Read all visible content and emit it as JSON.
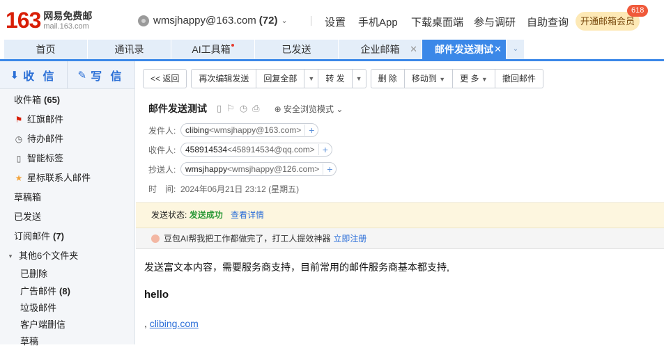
{
  "logo": {
    "number": "163",
    "cn": "网易免费邮",
    "url": "mail.163.com"
  },
  "account": {
    "email": "wmsjhappy@163.com",
    "count": "(72)"
  },
  "topnav": [
    "设置",
    "手机App",
    "下载桌面端",
    "参与调研",
    "自助查询"
  ],
  "vip": {
    "label": "开通邮箱会员",
    "badge": "618"
  },
  "tabs": [
    {
      "label": "首页"
    },
    {
      "label": "通讯录"
    },
    {
      "label": "AI工具箱"
    },
    {
      "label": "已发送"
    },
    {
      "label": "企业邮箱"
    },
    {
      "label": "邮件发送测试"
    }
  ],
  "compose": {
    "receive": "收 信",
    "write": "写 信"
  },
  "sidebar": {
    "inbox": {
      "label": "收件箱",
      "count": "(65)"
    },
    "flagged": "红旗邮件",
    "todo": "待办邮件",
    "smart_tags": "智能标签",
    "star_contacts": "星标联系人邮件",
    "drafts": "草稿箱",
    "sent": "已发送",
    "subscribed": {
      "label": "订阅邮件",
      "count": "(7)"
    },
    "other_folders": "其他6个文件夹",
    "deleted": "已删除",
    "ads": {
      "label": "广告邮件",
      "count": "(8)"
    },
    "spam": "垃圾邮件",
    "client_deleted": "客户端删信",
    "cutoff": "草稿"
  },
  "toolbar": {
    "back": "<< 返回",
    "reedit": "再次编辑发送",
    "reply_all": "回复全部",
    "forward": "转 发",
    "delete": "删 除",
    "move_to": "移动到",
    "more": "更 多",
    "recall": "撤回邮件"
  },
  "mail": {
    "subject": "邮件发送测试",
    "safe_mode": "安全浏览模式",
    "labels": {
      "from": "发件人:",
      "to": "收件人:",
      "cc": "抄送人:",
      "time": "时　间:"
    },
    "from": {
      "name": "clibing",
      "email": "<wmsjhappy@163.com>"
    },
    "to": {
      "name": "458914534",
      "email": "<458914534@qq.com>"
    },
    "cc": {
      "name": "wmsjhappy",
      "email": "<wmsjhappy@126.com>"
    },
    "time": "2024年06月21日 23:12 (星期五)"
  },
  "status": {
    "label": "发送状态:",
    "value": "发送成功",
    "link": "查看详情"
  },
  "ai_banner": {
    "text": "豆包AI帮我把工作都做完了，打工人提效神器",
    "link": "立即注册"
  },
  "body": {
    "line1": "发送富文本内容，需要服务商支持，目前常用的邮件服务商基本都支持,",
    "hello": "hello",
    "prefix": ", ",
    "link": "clibing.com"
  }
}
